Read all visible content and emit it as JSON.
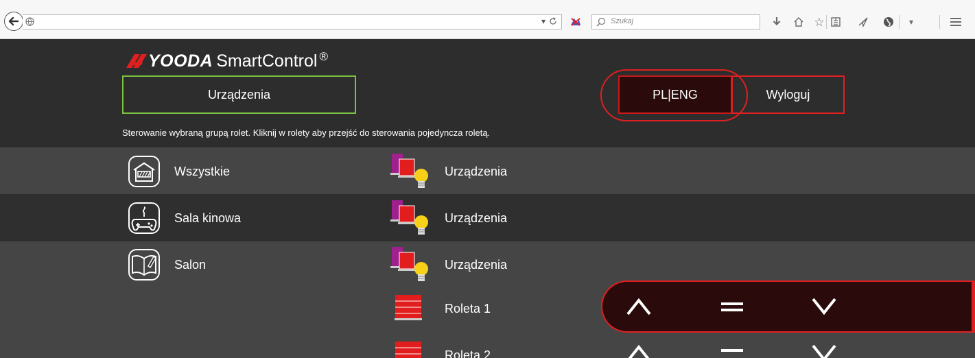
{
  "browser": {
    "search_placeholder": "Szukaj"
  },
  "app": {
    "brand_yooda": "YOODA",
    "brand_smartcontrol": "SmartControl",
    "brand_reg": "®",
    "devices_button": "Urządzenia",
    "lang_button": "PL|ENG",
    "logout_button": "Wyloguj",
    "hint": "Sterowanie wybraną grupą rolet. Kliknij w rolety aby przejść do sterowania pojedyncza roletą."
  },
  "rows": [
    {
      "room": "Wszystkie",
      "room_icon": "house-icon",
      "device": "Urządzenia",
      "device_icon": "devices-group-icon"
    },
    {
      "room": "Sala kinowa",
      "room_icon": "gamepad-icon",
      "device": "Urządzenia",
      "device_icon": "devices-group-icon"
    },
    {
      "room": "Salon",
      "room_icon": "book-icon",
      "device": "Urządzenia",
      "device_icon": "devices-group-icon"
    },
    {
      "room": "",
      "device": "Roleta 1",
      "device_icon": "blind-icon"
    },
    {
      "room": "",
      "device": "Roleta 2",
      "device_icon": "blind-icon"
    }
  ],
  "colors": {
    "accent_green": "#7cc242",
    "accent_red": "#e02020",
    "row_light": "#454545",
    "row_dark": "#2f2f2f"
  }
}
